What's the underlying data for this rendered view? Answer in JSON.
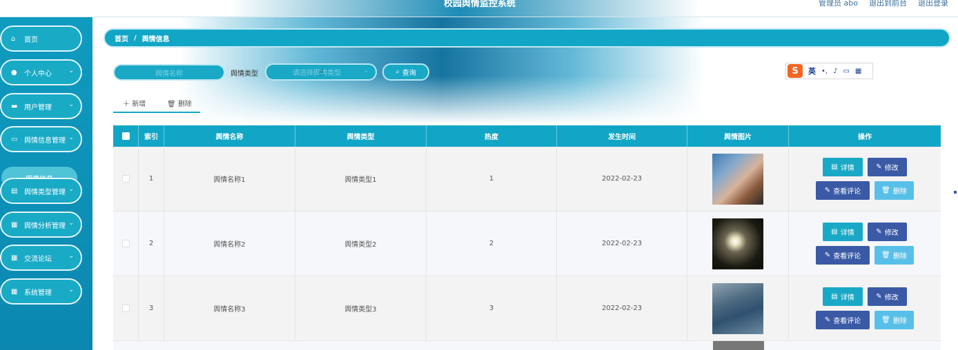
{
  "app_title": "校园舆情监控系统",
  "top_links": [
    "管理员 abo",
    "退出到前台",
    "退出登录"
  ],
  "sidebar": {
    "items": [
      {
        "label": "首页",
        "icon": "home-icon",
        "has_chevron": false
      },
      {
        "label": "个人中心",
        "icon": "user-icon",
        "has_chevron": true
      },
      {
        "label": "用户管理",
        "icon": "chat-icon",
        "has_chevron": true
      },
      {
        "label": "舆情信息管理",
        "icon": "briefcase-icon",
        "has_chevron": true
      },
      {
        "label": "舆情类型管理",
        "icon": "clipboard-icon",
        "has_chevron": true
      },
      {
        "label": "舆情分析管理",
        "icon": "grid-icon",
        "has_chevron": true
      },
      {
        "label": "交流论坛",
        "icon": "grid-icon",
        "has_chevron": true
      },
      {
        "label": "系统管理",
        "icon": "grid-icon",
        "has_chevron": true
      }
    ],
    "sub_item": "舆情信息"
  },
  "breadcrumb": {
    "home": "首页",
    "separator": "/",
    "current": "舆情信息"
  },
  "search": {
    "name_placeholder": "舆情名称",
    "type_label": "舆情类型",
    "type_placeholder": "请选择舆情类型",
    "query_label": "查询"
  },
  "ime": {
    "text": "英"
  },
  "toolbar": {
    "add_label": "新增",
    "delete_label": "删除"
  },
  "table": {
    "headers": [
      "",
      "索引",
      "舆情名称",
      "舆情类型",
      "热度",
      "发生时间",
      "舆情图片",
      "操作"
    ],
    "rows": [
      {
        "index": "1",
        "name": "舆情名称1",
        "type": "舆情类型1",
        "heat": "1",
        "date": "2022-02-23"
      },
      {
        "index": "2",
        "name": "舆情名称2",
        "type": "舆情类型2",
        "heat": "2",
        "date": "2022-02-23"
      },
      {
        "index": "3",
        "name": "舆情名称3",
        "type": "舆情类型3",
        "heat": "3",
        "date": "2022-02-23"
      }
    ],
    "actions": {
      "detail": "详情",
      "edit": "修改",
      "comment": "查看评论",
      "delete": "删除"
    }
  },
  "colors": {
    "primary": "#12a6c6",
    "button_dark": "#3a5aa6",
    "button_light": "#58c0e8",
    "sidebar": "#0f9bc0"
  }
}
